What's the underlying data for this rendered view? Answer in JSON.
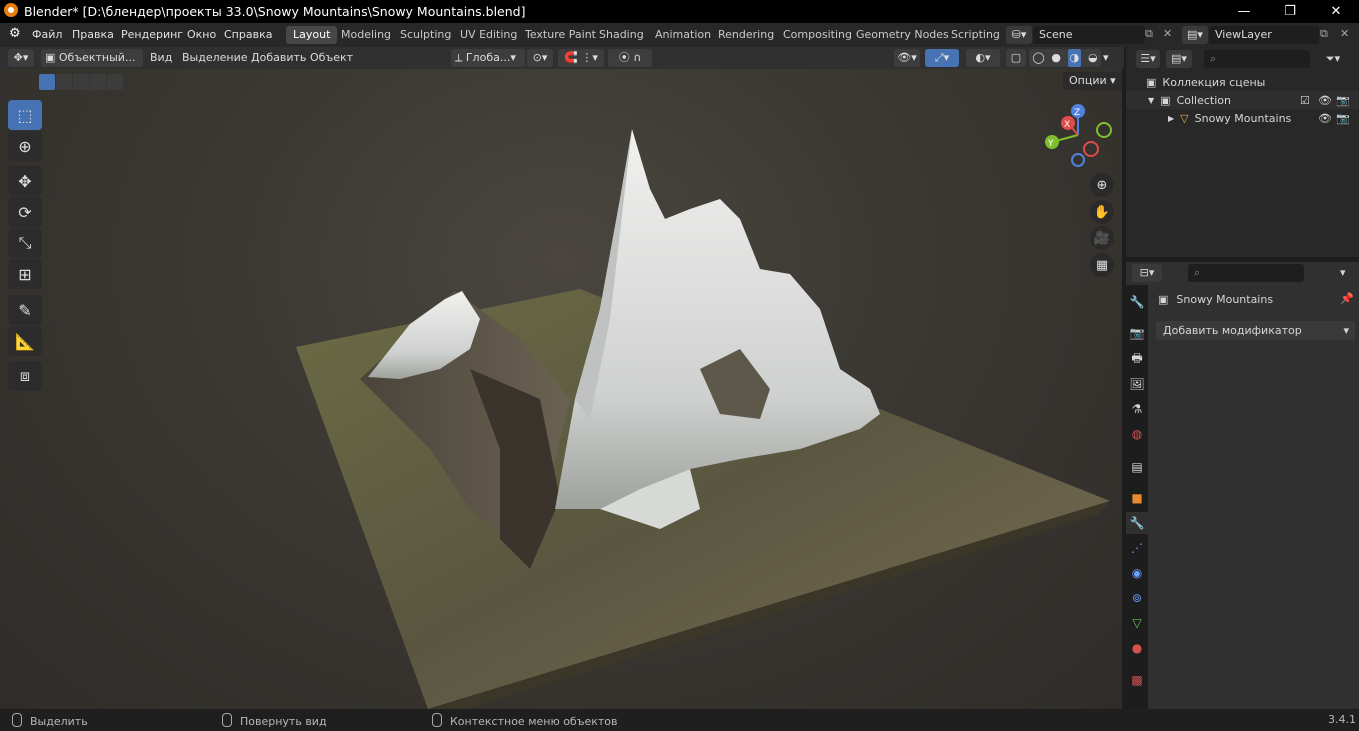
{
  "window": {
    "title": "Blender* [D:\\блендер\\проекты 33.0\\Snowy Mountains\\Snowy Mountains.blend]",
    "minimize": "—",
    "maximize": "❐",
    "close": "✕"
  },
  "menu": {
    "items": [
      "Файл",
      "Правка",
      "Рендеринг",
      "Окно",
      "Справка"
    ],
    "workspaces": [
      "Layout",
      "Modeling",
      "Sculpting",
      "UV Editing",
      "Texture Paint",
      "Shading",
      "Animation",
      "Rendering",
      "Compositing",
      "Geometry Nodes",
      "Scripting"
    ],
    "active_workspace": "Layout",
    "scene": "Scene",
    "view_layer": "ViewLayer"
  },
  "viewport_header": {
    "mode": "Объектный...",
    "menus": [
      "Вид",
      "Выделение",
      "Добавить",
      "Объект"
    ],
    "transform_orientation": "Глоба...",
    "options": "Опции"
  },
  "tools": [
    "select-box-icon",
    "cursor-icon",
    "move-icon",
    "rotate-icon",
    "scale-icon",
    "transform-icon",
    "annotate-icon",
    "measure-icon",
    "add-cube-icon"
  ],
  "gizmo": {
    "x": "X",
    "y": "Y",
    "z": "Z"
  },
  "outliner": {
    "root": "Коллекция сцены",
    "collection": "Collection",
    "object": "Snowy Mountains"
  },
  "properties": {
    "object_name": "Snowy Mountains",
    "add_modifier": "Добавить модификатор"
  },
  "statusbar": {
    "select": "Выделить",
    "rotate_view": "Повернуть вид",
    "context_menu": "Контекстное меню объектов",
    "version": "3.4.1"
  },
  "colors": {
    "accent": "#4772b3",
    "brand": "#e87d0d"
  }
}
